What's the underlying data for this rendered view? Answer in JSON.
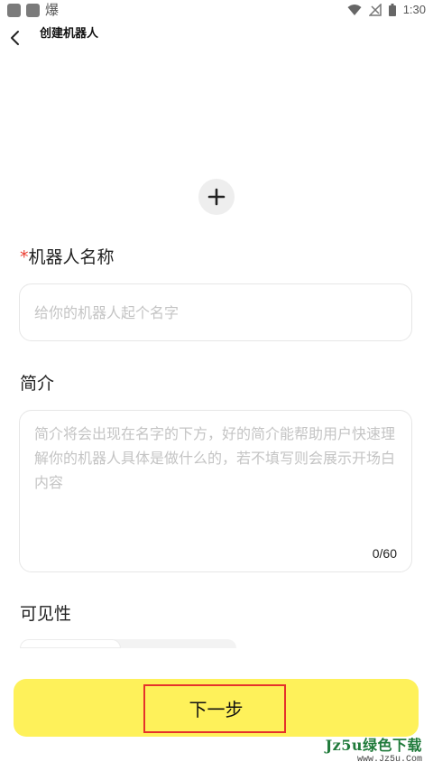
{
  "status_bar": {
    "notification_char": "爆",
    "time": "1:30"
  },
  "header": {
    "title": "创建机器人"
  },
  "form": {
    "name_required_mark": "*",
    "name_label": "机器人名称",
    "name_placeholder": "给你的机器人起个名字",
    "name_value": "",
    "intro_label": "简介",
    "intro_placeholder": "简介将会出现在名字的下方，好的简介能帮助用户快速理解你的机器人具体是做什么的，若不填写则会展示开场白内容",
    "intro_counter": "0/60",
    "visibility_label": "可见性"
  },
  "actions": {
    "next_label": "下一步"
  },
  "watermark": {
    "main": "Jz5u绿色下载",
    "sub": "www.Jz5u.Com"
  },
  "colors": {
    "accent_yellow": "#fef15a",
    "required_red": "#ea3b2f",
    "highlight_red": "#e5322b",
    "watermark_green": "#1f7a3a"
  },
  "icons": {
    "back": "chevron-left-icon",
    "add": "plus-icon",
    "wifi": "wifi-icon",
    "signal": "signal-off-icon",
    "battery": "battery-icon"
  }
}
